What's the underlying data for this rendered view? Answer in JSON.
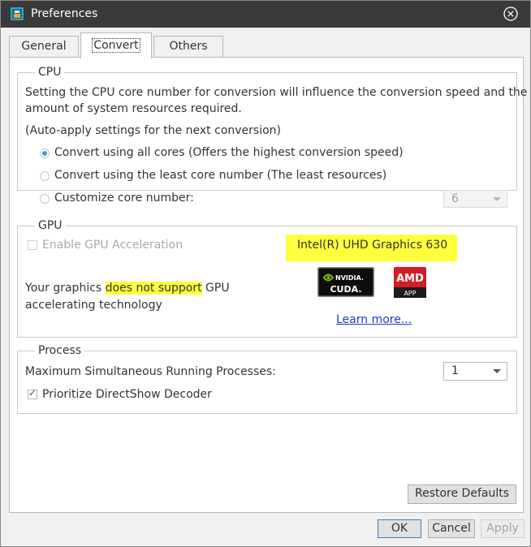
{
  "window": {
    "title": "Preferences"
  },
  "tabs": [
    {
      "label": "General",
      "active": false
    },
    {
      "label": "Convert",
      "active": true
    },
    {
      "label": "Others",
      "active": false
    }
  ],
  "cpu": {
    "title": "CPU",
    "description_line1": "Setting the CPU core number for conversion will influence the conversion speed and the",
    "description_line2": "amount of system resources required.",
    "auto_apply_note": "(Auto-apply settings for the next conversion)",
    "options": [
      {
        "label": "Convert using all cores (Offers the highest conversion speed)",
        "selected": true
      },
      {
        "label": "Convert using the least core number (The least resources)",
        "selected": false
      },
      {
        "label": "Customize core number:",
        "selected": false
      }
    ],
    "core_number_value": "6"
  },
  "gpu": {
    "title": "GPU",
    "enable_label": "Enable GPU Acceleration",
    "enable_checked": false,
    "graphics_name": "Intel(R) UHD Graphics 630",
    "support_text_part1": "Your graphics ",
    "support_text_highlight": "does not support",
    "support_text_part2": " GPU",
    "support_text_line2": "accelerating technology",
    "nvidia_logo_line1": "NVIDIA.",
    "nvidia_logo_line2": "CUDA.",
    "amd_logo_line1": "AMD",
    "amd_logo_line2": "APP",
    "learn_more_link": "Learn more..."
  },
  "process": {
    "title": "Process",
    "max_processes_label": "Maximum Simultaneous Running Processes:",
    "max_processes_value": "1",
    "prioritize_label": "Prioritize DirectShow Decoder",
    "prioritize_checked": true
  },
  "buttons": {
    "restore_defaults": "Restore Defaults",
    "ok": "OK",
    "cancel": "Cancel",
    "apply": "Apply"
  },
  "colors": {
    "titlebar": "#3a3a3a",
    "highlight": "#ffff3b",
    "radio_selected": "#3b9cdc",
    "link": "#1a3ad4",
    "amd_red": "#d21f26"
  }
}
